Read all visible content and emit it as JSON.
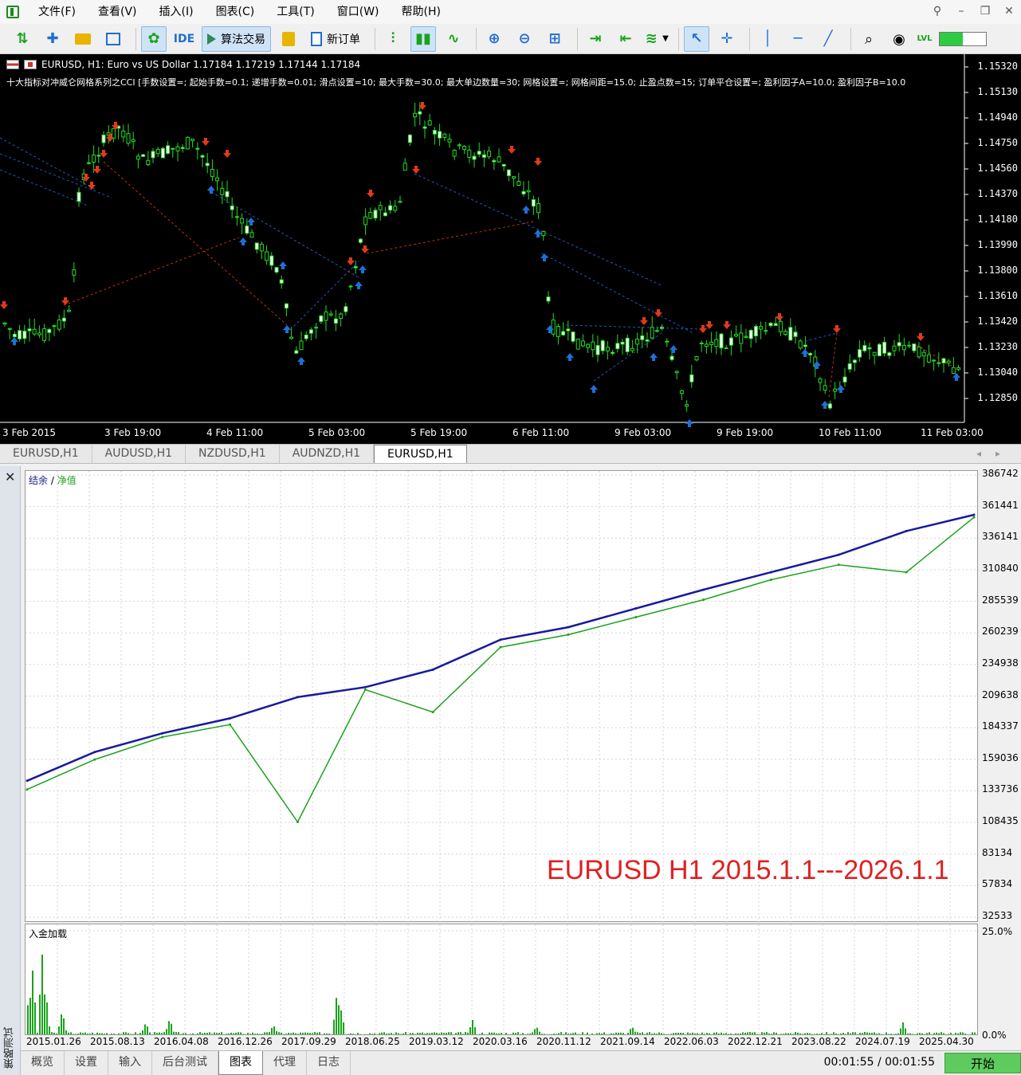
{
  "menu": [
    "文件(F)",
    "查看(V)",
    "插入(I)",
    "图表(C)",
    "工具(T)",
    "窗口(W)",
    "帮助(H)"
  ],
  "toolbar": {
    "ide_label": "IDE",
    "algo_label": "算法交易",
    "new_order_label": "新订单",
    "level_label": "LVL",
    "level_percent": 50
  },
  "chart": {
    "header": "EURUSD, H1:  Euro vs US Dollar  1.17184 1.17219 1.17144 1.17184",
    "params": "十大指标对冲威仑网格系列之CCI [手数设置=; 起始手数=0.1; 递增手数=0.01; 滑点设置=10; 最大手数=30.0; 最大单边数量=30; 网格设置=; 网格间距=15.0; 止盈点数=15; 订单平仓设置=; 盈利因子A=10.0; 盈利因子B=10.0",
    "price_ticks": [
      "1.15320",
      "1.15130",
      "1.14940",
      "1.14750",
      "1.14560",
      "1.14370",
      "1.14180",
      "1.13990",
      "1.13800",
      "1.13610",
      "1.13420",
      "1.13230",
      "1.13040",
      "1.12850"
    ],
    "time_ticks": [
      "3 Feb 2015",
      "3 Feb 19:00",
      "4 Feb 11:00",
      "5 Feb 03:00",
      "5 Feb 19:00",
      "6 Feb 11:00",
      "9 Feb 03:00",
      "9 Feb 19:00",
      "10 Feb 11:00",
      "11 Feb 03:00"
    ],
    "colors": {
      "bull": "#ffffff",
      "bear": "#000000",
      "wick": "#22dd22",
      "buy": "#1e6fd9",
      "sell": "#e03a1a"
    }
  },
  "chart_tabs": [
    "EURUSD,H1",
    "AUDUSD,H1",
    "NZDUSD,H1",
    "AUDNZD,H1",
    "EURUSD,H1"
  ],
  "chart_tab_active": 4,
  "tester": {
    "side_label": "策略测试",
    "legend_balance": "结余",
    "legend_sep": " / ",
    "legend_equity": "净值",
    "deposit_label": "入金加载",
    "watermark": "EURUSD H1 2015.1.1---2026.1.1",
    "timer": "00:01:55 / 00:01:55",
    "start_label": "开始",
    "bottom_tabs": [
      "概览",
      "设置",
      "输入",
      "后台测试",
      "图表",
      "代理",
      "日志"
    ],
    "bottom_tab_active": 4
  },
  "chart_data": [
    {
      "type": "line",
      "title": "",
      "series": [
        {
          "name": "结余",
          "color": "#1a1a9a",
          "x": [
            "2015.01.26",
            "2015.08.13",
            "2016.04.08",
            "2016.12.26",
            "2017.09.29",
            "2018.06.25",
            "2019.03.12",
            "2020.03.16",
            "2020.11.12",
            "2021.09.14",
            "2022.06.03",
            "2022.12.21",
            "2023.08.22",
            "2024.07.19",
            "2025.04.30"
          ],
          "values": [
            145000,
            168000,
            183000,
            195000,
            212000,
            220000,
            234000,
            258000,
            268000,
            283000,
            298000,
            312000,
            326000,
            345000,
            358000
          ]
        },
        {
          "name": "净值",
          "color": "#1aa31a",
          "x": [
            "2015.01.26",
            "2015.08.13",
            "2016.04.08",
            "2016.12.26",
            "2017.09.29",
            "2018.06.25",
            "2019.03.12",
            "2020.03.16",
            "2020.11.12",
            "2021.09.14",
            "2022.06.03",
            "2022.12.21",
            "2023.08.22",
            "2024.07.19",
            "2025.04.30"
          ],
          "values": [
            138000,
            162000,
            180000,
            190000,
            112000,
            218000,
            200000,
            252000,
            262000,
            276000,
            290000,
            306000,
            318000,
            312000,
            356000
          ]
        }
      ],
      "y_ticks": [
        "386742",
        "361441",
        "336141",
        "310840",
        "285539",
        "260239",
        "234938",
        "209638",
        "184337",
        "159036",
        "133736",
        "108435",
        "83134",
        "57834",
        "32533"
      ],
      "ylim": [
        32533,
        386742
      ],
      "x_ticks": [
        "2015.01.26",
        "2015.08.13",
        "2016.04.08",
        "2016.12.26",
        "2017.09.29",
        "2018.06.25",
        "2019.03.12",
        "2020.03.16",
        "2020.11.12",
        "2021.09.14",
        "2022.06.03",
        "2022.12.21",
        "2023.08.22",
        "2024.07.19",
        "2025.04.30"
      ],
      "grid": true
    },
    {
      "type": "bar",
      "title": "",
      "y_ticks": [
        "25.0%",
        "0.0%"
      ],
      "ylim": [
        0,
        25
      ]
    }
  ]
}
